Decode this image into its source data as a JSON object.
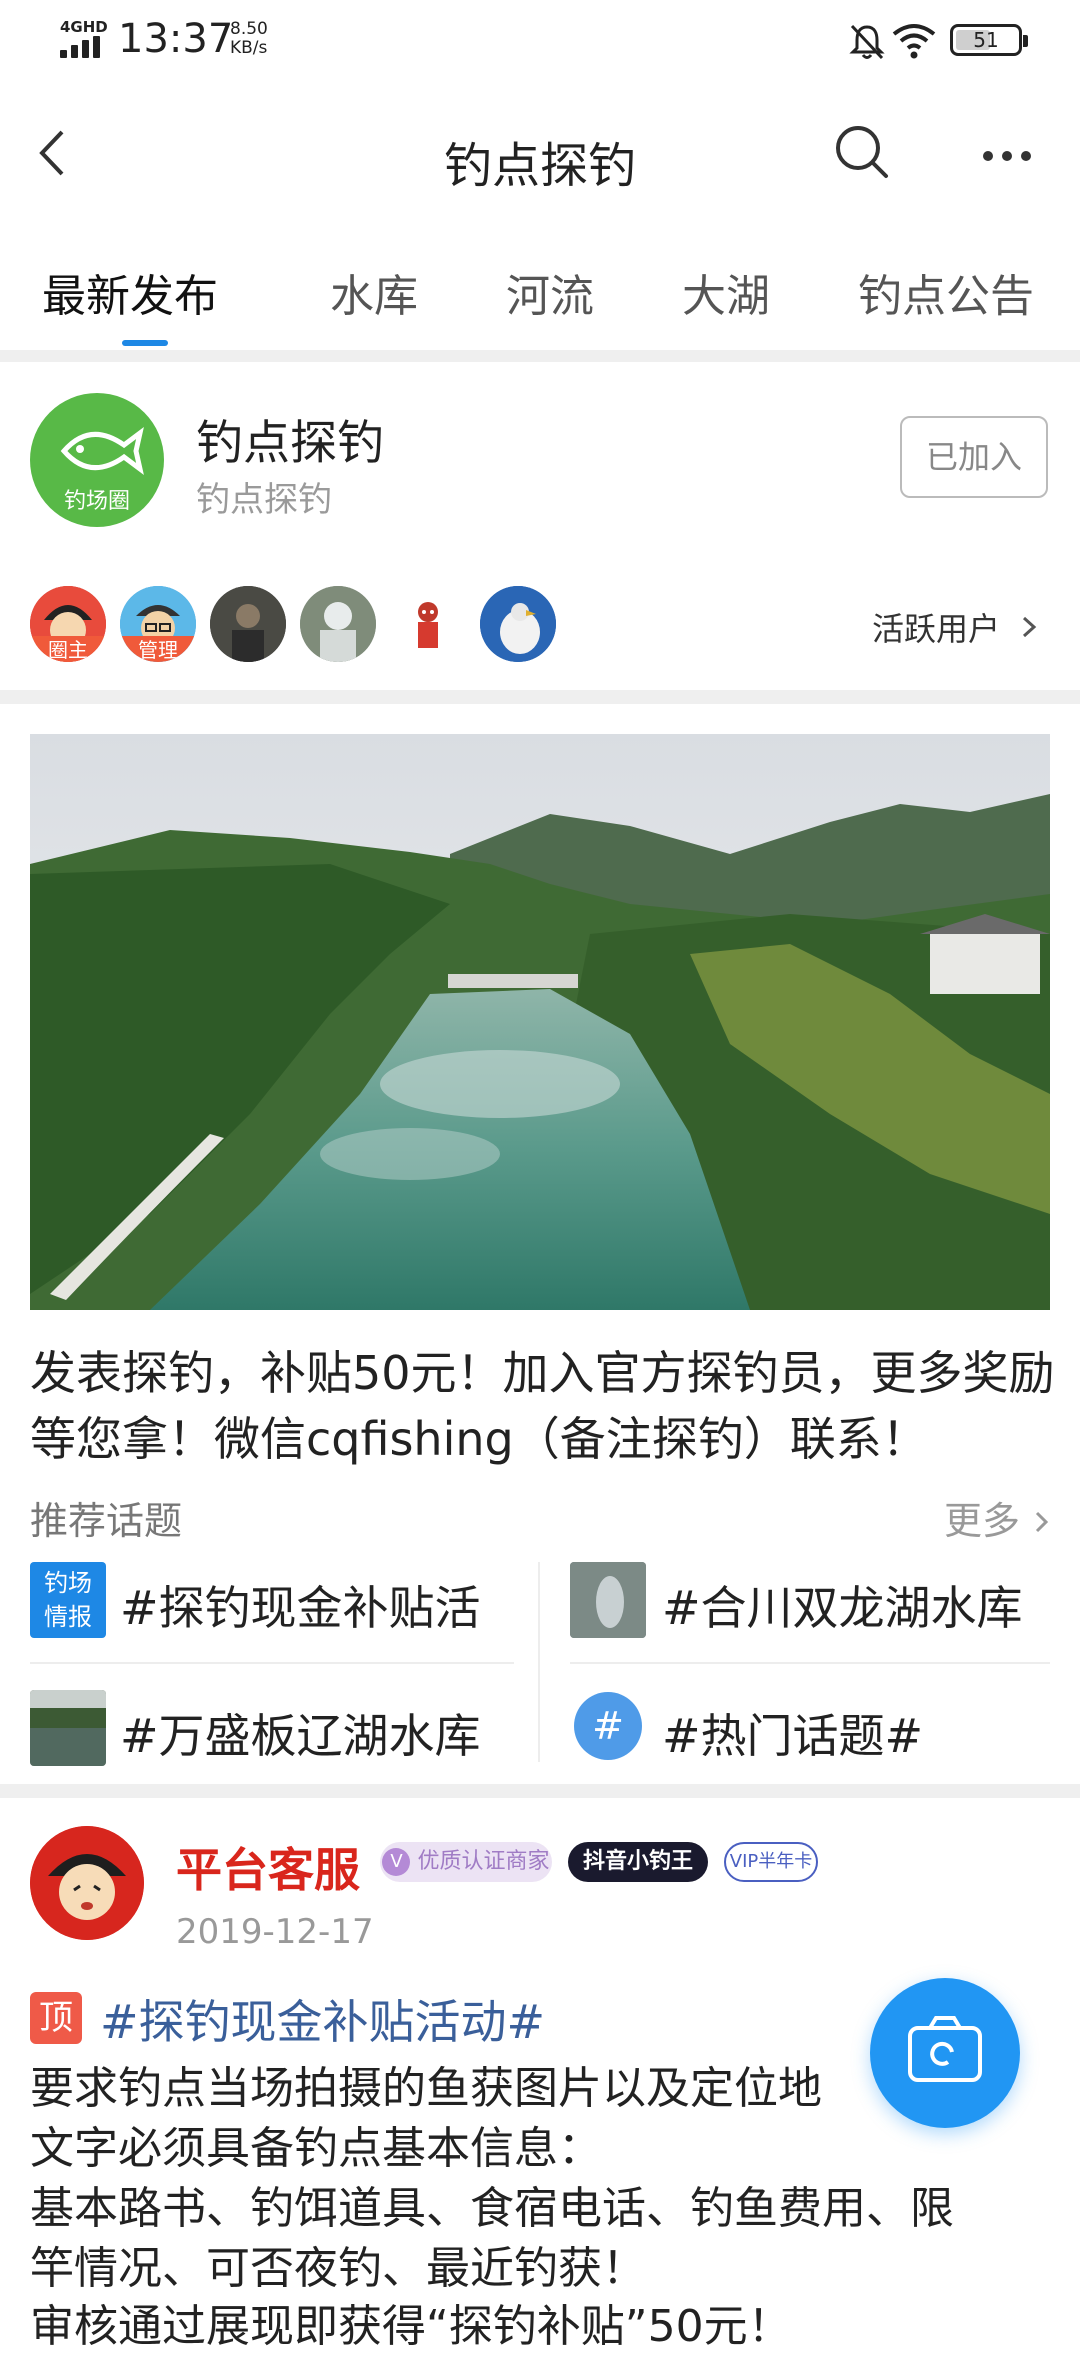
{
  "status_bar": {
    "network_label": "4GHD",
    "time": "13:37",
    "speed_value": "8.50",
    "speed_unit": "KB/s",
    "battery": "51"
  },
  "nav": {
    "title": "钓点探钓"
  },
  "tabs": [
    {
      "label": "最新发布",
      "active": true
    },
    {
      "label": "水库"
    },
    {
      "label": "河流"
    },
    {
      "label": "大湖"
    },
    {
      "label": "钓点公告"
    }
  ],
  "group": {
    "logo_text": "钓场圈",
    "name": "钓点探钓",
    "subtitle": "钓点探钓",
    "join_label": "已加入",
    "avatar_tags": [
      "圈主",
      "管理"
    ],
    "active_users_label": "活跃用户"
  },
  "announcement": {
    "text": "发表探钓，补贴50元！加入官方探钓员，更多奖励等您拿！微信cqfishing（备注探钓）联系！"
  },
  "topics": {
    "title": "推荐话题",
    "more_label": "更多",
    "items": [
      {
        "label": "#探钓现金补贴活",
        "thumb_text": "钓场情报"
      },
      {
        "label": "#合川双龙湖水库"
      },
      {
        "label": "#万盛板辽湖水库"
      },
      {
        "label": "#热门话题#",
        "thumb_text": "#"
      }
    ]
  },
  "post": {
    "author": "平台客服",
    "badges": [
      "优质认证商家",
      "抖音小钓王",
      "VIP半年卡"
    ],
    "date": "2019-12-17",
    "pin_label": "顶",
    "topic": "#探钓现金补贴活动#",
    "lines": [
      "要求钓点当场拍摄的鱼获图片以及定位地",
      "文字必须具备钓点基本信息：",
      "基本路书、钓饵道具、食宿电话、钓鱼费用、限",
      "竿情况、可否夜钓、最近钓获！",
      "审核通过展现即获得“探钓补贴”50元！"
    ]
  },
  "colors": {
    "accent": "#1e88e5",
    "author_red": "#d9261c",
    "logo_green": "#58b947"
  }
}
